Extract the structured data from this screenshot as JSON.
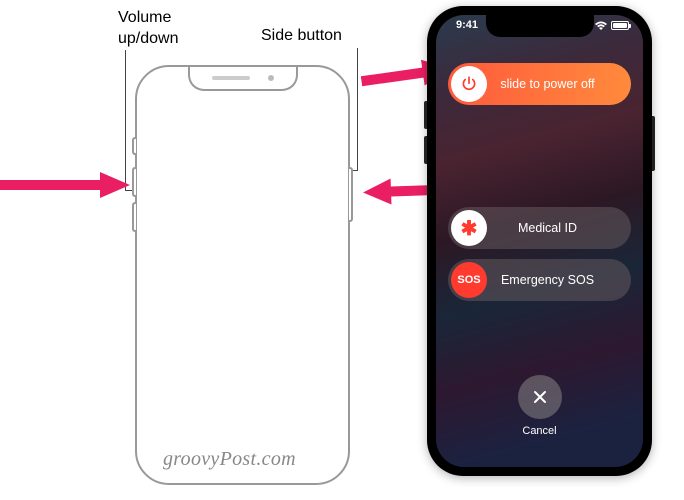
{
  "labels": {
    "volume": "Volume\nup/down",
    "side": "Side button"
  },
  "watermark": "groovyPost.com",
  "phone": {
    "status": {
      "time": "9:41"
    },
    "sliders": {
      "power": {
        "label": "slide to power off"
      },
      "medical": {
        "label": "Medical ID",
        "icon": "✱"
      },
      "sos": {
        "label": "Emergency SOS",
        "icon": "SOS"
      }
    },
    "cancel": {
      "label": "Cancel"
    }
  }
}
